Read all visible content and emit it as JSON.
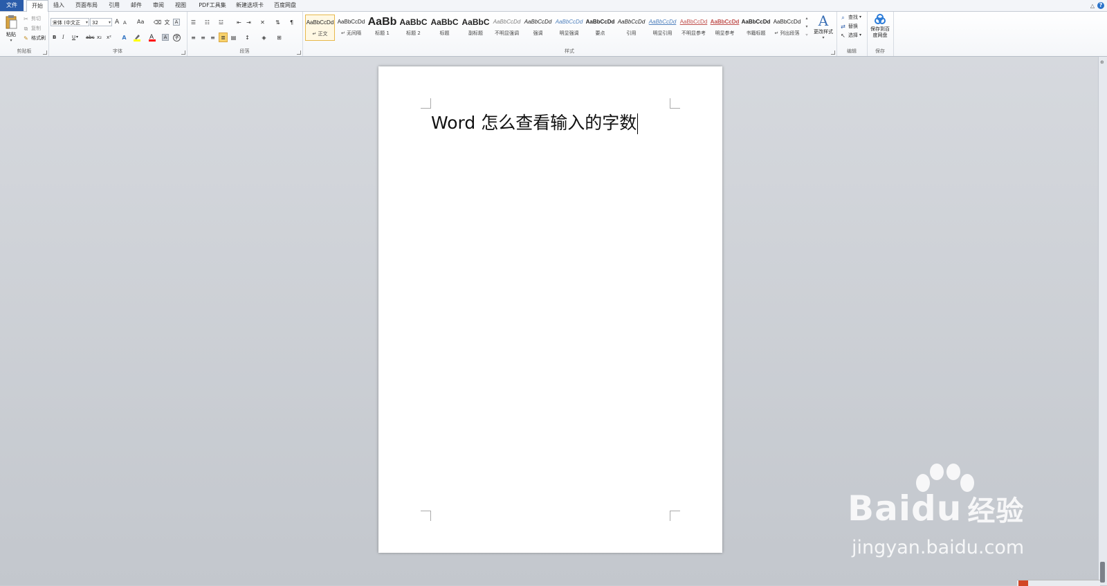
{
  "tabs": [
    "文件",
    "开始",
    "插入",
    "页面布局",
    "引用",
    "邮件",
    "审阅",
    "视图",
    "PDF工具集",
    "新建选项卡",
    "百度网盘"
  ],
  "active_tab": "开始",
  "window_controls": {
    "minimize": "△",
    "help": "?"
  },
  "clipboard": {
    "paste": "粘贴",
    "cut": "剪切",
    "copy": "复制",
    "format_painter": "格式刷",
    "label": "剪贴板"
  },
  "font": {
    "font_name": "宋体 (中文正",
    "font_size": "32",
    "grow": "A",
    "shrink": "A",
    "change_case": "Aa",
    "bold": "B",
    "italic": "I",
    "underline": "U",
    "strikethrough": "abc",
    "subscript": "x₂",
    "superscript": "x²",
    "label": "字体"
  },
  "paragraph": {
    "label": "段落"
  },
  "styles": {
    "items": [
      {
        "preview": "AaBbCcDd",
        "name": "↵ 正文"
      },
      {
        "preview": "AaBbCcDd",
        "name": "↵ 无间隔"
      },
      {
        "preview": "AaBb",
        "name": "标题 1"
      },
      {
        "preview": "AaBbC",
        "name": "标题 2"
      },
      {
        "preview": "AaBbC",
        "name": "标题"
      },
      {
        "preview": "AaBbC",
        "name": "副标题"
      },
      {
        "preview": "AaBbCcDd",
        "name": "不明显强调"
      },
      {
        "preview": "AaBbCcDd",
        "name": "强调"
      },
      {
        "preview": "AaBbCcDd",
        "name": "明显强调"
      },
      {
        "preview": "AaBbCcDd",
        "name": "要点"
      },
      {
        "preview": "AaBbCcDd",
        "name": "引用"
      },
      {
        "preview": "AaBbCcDd",
        "name": "明显引用"
      },
      {
        "preview": "AaBbCcDd",
        "name": "不明显参考"
      },
      {
        "preview": "AaBbCcDd",
        "name": "明显参考"
      },
      {
        "preview": "AaBbCcDd",
        "name": "书籍标题"
      },
      {
        "preview": "AaBbCcDd",
        "name": "↵ 列出段落"
      }
    ],
    "change_styles": "更改样式",
    "label": "样式"
  },
  "editing": {
    "find": "查找",
    "replace": "替换",
    "select": "选择",
    "label": "编辑"
  },
  "save": {
    "button": "保存到百度网盘",
    "label": "保存"
  },
  "document": {
    "text": "Word 怎么查看输入的字数"
  },
  "watermark": {
    "main": "Bai",
    "main2": "du",
    "cn": "经验",
    "sub": "jingyan.baidu.com"
  },
  "colors": {
    "file_tab": "#2a5caa",
    "style_selected_border": "#e7b84a",
    "subtle_emphasis": "#7f7f7f",
    "emphasis_blue": "#4f81bd",
    "reference_red": "#c0504d",
    "highlight_yellow": "#ffff00",
    "font_color_red": "#ff0000",
    "save_icon_blue": "#2a7bd8"
  }
}
